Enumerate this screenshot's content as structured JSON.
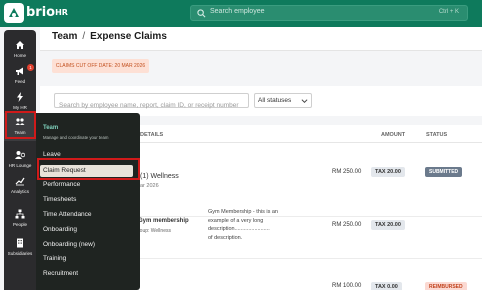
{
  "app": {
    "brand_name": "brio",
    "brand_suffix": "HR",
    "brand_color": "#0e7a5c"
  },
  "search": {
    "placeholder": "Search employee",
    "shortcut": "Ctrl + K"
  },
  "rail": {
    "items": [
      {
        "label": "Home",
        "icon": "home-icon"
      },
      {
        "label": "Feed",
        "icon": "megaphone-icon",
        "badge": "1"
      },
      {
        "label": "My HR",
        "icon": "lightning-icon"
      },
      {
        "label": "Team",
        "icon": "people-icon"
      },
      {
        "label": "HR Lounge",
        "icon": "person-chat-icon"
      },
      {
        "label": "Analytics",
        "icon": "chart-icon"
      },
      {
        "label": "People",
        "icon": "org-chart-icon"
      },
      {
        "label": "Subsidiaries",
        "icon": "building-icon"
      }
    ]
  },
  "breadcrumb": {
    "parent": "Team",
    "separator": "/",
    "current": "Expense Claims"
  },
  "cutoff_banner": "CLAIMS CUT OFF DATE: 20 MAR 2026",
  "filters": {
    "search_placeholder": "Search by employee name, report, claim ID, or receipt number",
    "status_selected": "All statuses"
  },
  "table": {
    "headers": {
      "details": "DETAILS",
      "amount": "AMOUNT",
      "status": "STATUS"
    },
    "rows": [
      {
        "title": "(1) Wellness",
        "date": "ar 2026",
        "amount": "RM 250.00",
        "tax": "TAX 20.00",
        "status": "SUBMITTED"
      },
      {
        "title": "Gym membership",
        "group": "roup: Wellness",
        "description_lines": [
          "Gym Membership - this is an",
          "example of a very long",
          "description.......................",
          "of description."
        ],
        "amount": "RM 250.00",
        "tax": "TAX 20.00"
      },
      {
        "amount": "RM 100.00",
        "tax": "TAX 0.00",
        "status": "REIMBURSED"
      }
    ]
  },
  "menu": {
    "title": "Team",
    "subtitle": "Manage and coordinate your team",
    "items": [
      "Leave",
      "Claim Request",
      "Performance",
      "Timesheets",
      "Time Attendance",
      "Onboarding",
      "Onboarding (new)",
      "Training",
      "Recruitment"
    ],
    "selected": "Claim Request"
  }
}
